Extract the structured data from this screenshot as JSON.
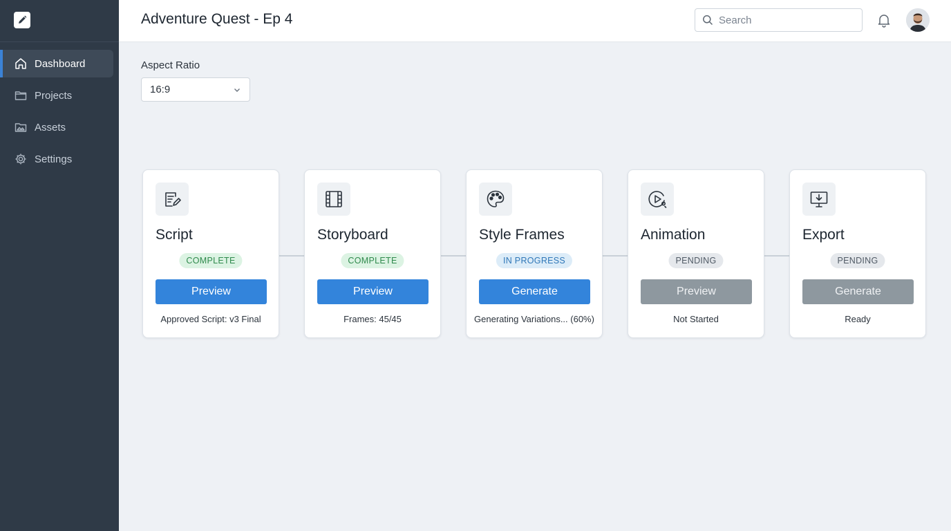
{
  "app": {
    "logo_icon": "pencil-edit-icon"
  },
  "sidebar": {
    "items": [
      {
        "label": "Dashboard",
        "icon": "home-icon",
        "active": true
      },
      {
        "label": "Projects",
        "icon": "folder-icon",
        "active": false
      },
      {
        "label": "Assets",
        "icon": "image-folder-icon",
        "active": false
      },
      {
        "label": "Settings",
        "icon": "gear-icon",
        "active": false
      }
    ]
  },
  "header": {
    "title": "Adventure Quest - Ep 4",
    "search_placeholder": "Search"
  },
  "aspect_ratio": {
    "label": "Aspect Ratio",
    "value": "16:9"
  },
  "pipeline": [
    {
      "title": "Script",
      "icon": "script-edit-icon",
      "status": "COMPLETE",
      "status_kind": "complete",
      "button": "Preview",
      "button_enabled": true,
      "detail": "Approved Script: v3 Final"
    },
    {
      "title": "Storyboard",
      "icon": "film-strip-icon",
      "status": "COMPLETE",
      "status_kind": "complete",
      "button": "Preview",
      "button_enabled": true,
      "detail": "Frames: 45/45"
    },
    {
      "title": "Style Frames",
      "icon": "palette-icon",
      "status": "IN PROGRESS",
      "status_kind": "progress",
      "button": "Generate",
      "button_enabled": true,
      "detail": "Generating Variations... (60%)"
    },
    {
      "title": "Animation",
      "icon": "play-motion-icon",
      "status": "PENDING",
      "status_kind": "pending",
      "button": "Preview",
      "button_enabled": false,
      "detail": "Not Started"
    },
    {
      "title": "Export",
      "icon": "monitor-download-icon",
      "status": "PENDING",
      "status_kind": "pending",
      "button": "Generate",
      "button_enabled": false,
      "detail": "Ready"
    }
  ],
  "colors": {
    "sidebar_bg": "#2f3a47",
    "accent": "#3384db",
    "complete": "#2f8a4c",
    "in_progress": "#2f77b8",
    "pending": "#505a65",
    "disabled_button": "#8e989f"
  }
}
